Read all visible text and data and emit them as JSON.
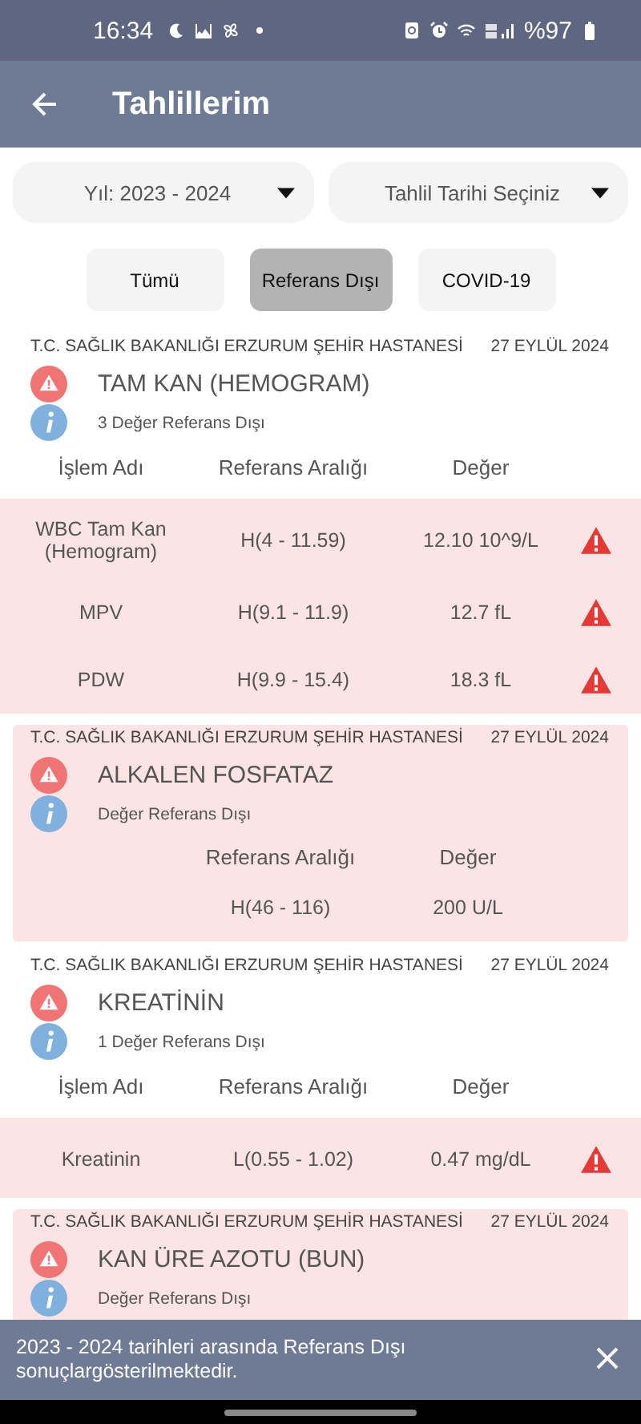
{
  "status_bar": {
    "time": "16:34",
    "battery": "%97"
  },
  "app_bar": {
    "title": "Tahlillerim"
  },
  "filters": [
    {
      "value": "Yıl: 2023 - 2024"
    },
    {
      "value": "Tahlil Tarihi Seçiniz"
    }
  ],
  "tabs": [
    {
      "label": "Tümü",
      "selected": false
    },
    {
      "label": "Referans Dışı",
      "selected": true
    },
    {
      "label": "COVID-19",
      "selected": false
    }
  ],
  "results": [
    {
      "hospital": "T.C. SAĞLIK BAKANLIĞI ERZURUM ŞEHİR HASTANESİ",
      "date": "27 EYLÜL 2024",
      "title": "TAM KAN (HEMOGRAM)",
      "info": "3 Değer Referans Dışı",
      "highlighted": false,
      "columns": [
        {
          "kind": "name",
          "label": "İşlem Adı"
        },
        {
          "kind": "range",
          "label": "Referans Aralığı"
        },
        {
          "kind": "value",
          "label": "Değer"
        }
      ],
      "rows": [
        {
          "name": "WBC  Tam Kan (Hemogram)",
          "range": "H(4 - 11.59)",
          "value": "12.10 10^9/L",
          "warning": true
        },
        {
          "name": "MPV",
          "range": "H(9.1 - 11.9)",
          "value": "12.7 fL",
          "warning": true
        },
        {
          "name": "PDW",
          "range": "H(9.9 - 15.4)",
          "value": "18.3 fL",
          "warning": true
        }
      ]
    },
    {
      "hospital": "T.C. SAĞLIK BAKANLIĞI ERZURUM ŞEHİR HASTANESİ",
      "date": "27 EYLÜL 2024",
      "title": "ALKALEN FOSFATAZ",
      "info": "Değer Referans Dışı",
      "highlighted": true,
      "columns": [
        {
          "kind": "range",
          "label": "Referans Aralığı"
        },
        {
          "kind": "value",
          "label": "Değer"
        }
      ],
      "rows": [
        {
          "range": "H(46 - 116)",
          "value": "200 U/L",
          "warning": false
        }
      ]
    },
    {
      "hospital": "T.C. SAĞLIK BAKANLIĞI ERZURUM ŞEHİR HASTANESİ",
      "date": "27 EYLÜL 2024",
      "title": "KREATİNİN",
      "info": "1 Değer Referans Dışı",
      "highlighted": false,
      "columns": [
        {
          "kind": "name",
          "label": "İşlem Adı"
        },
        {
          "kind": "range",
          "label": "Referans Aralığı"
        },
        {
          "kind": "value",
          "label": "Değer"
        }
      ],
      "rows": [
        {
          "name": "Kreatinin",
          "range": "L(0.55 - 1.02)",
          "value": "0.47 mg/dL",
          "warning": true
        }
      ]
    },
    {
      "hospital": "T.C. SAĞLIK BAKANLIĞI ERZURUM ŞEHİR HASTANESİ",
      "date": "27 EYLÜL 2024",
      "title": "KAN ÜRE AZOTU (BUN)",
      "info": "Değer Referans Dışı",
      "highlighted": true
    }
  ],
  "snackbar": {
    "message": "2023 - 2024 tarihleri arasında Referans Dışı sonuçlargösterilmektedir."
  }
}
